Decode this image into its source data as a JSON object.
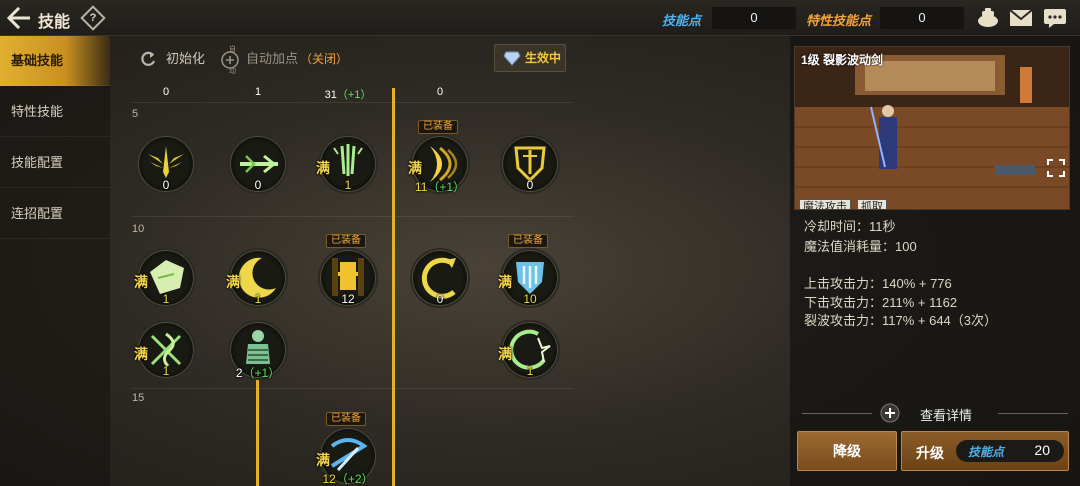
{
  "colors": {
    "accent_gold": "#e3b227",
    "skill_points_blue": "#4fb2ee",
    "trait_points_orange": "#f2a33b",
    "plus_green": "#5fe35f"
  },
  "header": {
    "title": "技能",
    "help_glyph": "?",
    "skill_points_label": "技能点",
    "skill_points_value": "0",
    "trait_points_label": "特性技能点",
    "trait_points_value": "0",
    "icons": [
      "back-arrow-icon",
      "help-icon",
      "treasure-pot-icon",
      "mail-icon",
      "chat-icon"
    ]
  },
  "sidebar": {
    "items": [
      {
        "label": "基础技能",
        "active": true
      },
      {
        "label": "特性技能",
        "active": false
      },
      {
        "label": "技能配置",
        "active": false
      },
      {
        "label": "连招配置",
        "active": false
      }
    ]
  },
  "actions": {
    "reset_label": "初始化",
    "auto_label": "自动加点",
    "auto_state": "（关闭）",
    "auto_badge": "自动",
    "effect_label": "生效中"
  },
  "tree": {
    "levels": [
      "5",
      "10",
      "15"
    ],
    "top_row_counts": [
      {
        "value": "0",
        "plus": ""
      },
      {
        "value": "1",
        "plus": ""
      },
      {
        "value": "31",
        "plus": "（+1）"
      },
      {
        "value": "0",
        "plus": ""
      }
    ],
    "skills": [
      {
        "id": "s5a",
        "icon": "winged-sword-icon",
        "count": "0",
        "plus": "",
        "maxed": false,
        "equipped": ""
      },
      {
        "id": "s5b",
        "icon": "dash-sword-icon",
        "count": "0",
        "plus": "",
        "maxed": false,
        "equipped": ""
      },
      {
        "id": "s5c",
        "icon": "triple-sword-icon",
        "count": "1",
        "plus": "",
        "maxed": true,
        "equipped": ""
      },
      {
        "id": "s5d",
        "icon": "crescent-slash-icon",
        "count": "11",
        "plus": "（+1）",
        "maxed": true,
        "equipped": "已装备"
      },
      {
        "id": "s5e",
        "icon": "shield-sword-icon",
        "count": "0",
        "plus": "",
        "maxed": false,
        "equipped": ""
      },
      {
        "id": "s10a",
        "icon": "burst-icon",
        "count": "1",
        "plus": "",
        "maxed": true,
        "equipped": ""
      },
      {
        "id": "s10b",
        "icon": "moon-icon",
        "count": "1",
        "plus": "",
        "maxed": true,
        "equipped": ""
      },
      {
        "id": "s10c",
        "icon": "gold-totem-icon",
        "count": "12",
        "plus": "",
        "maxed": false,
        "equipped": "已装备"
      },
      {
        "id": "s10d",
        "icon": "crescent-ring-icon",
        "count": "0",
        "plus": "",
        "maxed": false,
        "equipped": ""
      },
      {
        "id": "s10e",
        "icon": "shield-wave-icon",
        "count": "10",
        "plus": "",
        "maxed": true,
        "equipped": "已装备"
      },
      {
        "id": "s12a",
        "icon": "cross-slash-icon",
        "count": "1",
        "plus": "",
        "maxed": true,
        "equipped": ""
      },
      {
        "id": "s12b",
        "icon": "armored-figure-icon",
        "count": "2",
        "plus": "（+1）",
        "maxed": false,
        "equipped": ""
      },
      {
        "id": "s12c",
        "icon": "spiral-slash-icon",
        "count": "1",
        "plus": "",
        "maxed": true,
        "equipped": ""
      },
      {
        "id": "s15a",
        "icon": "blue-slash-icon",
        "count": "12",
        "plus": "（+2）",
        "maxed": true,
        "equipped": "已装备"
      }
    ],
    "maxed_mark": "满"
  },
  "detail": {
    "preview_title": "1级 裂影波动剑",
    "tags": [
      "魔法攻击",
      "抓取"
    ],
    "cooldown": "冷却时间：11秒",
    "mp_cost": "魔法值消耗量：100",
    "stats": [
      "上击攻击力：140% + 776",
      "下击攻击力：211% + 1162",
      "裂波攻击力：117% + 644（3次）"
    ],
    "view_details": "查看详情",
    "downgrade": "降级",
    "upgrade": "升级",
    "upgrade_points_label": "技能点",
    "upgrade_points_value": "20"
  }
}
